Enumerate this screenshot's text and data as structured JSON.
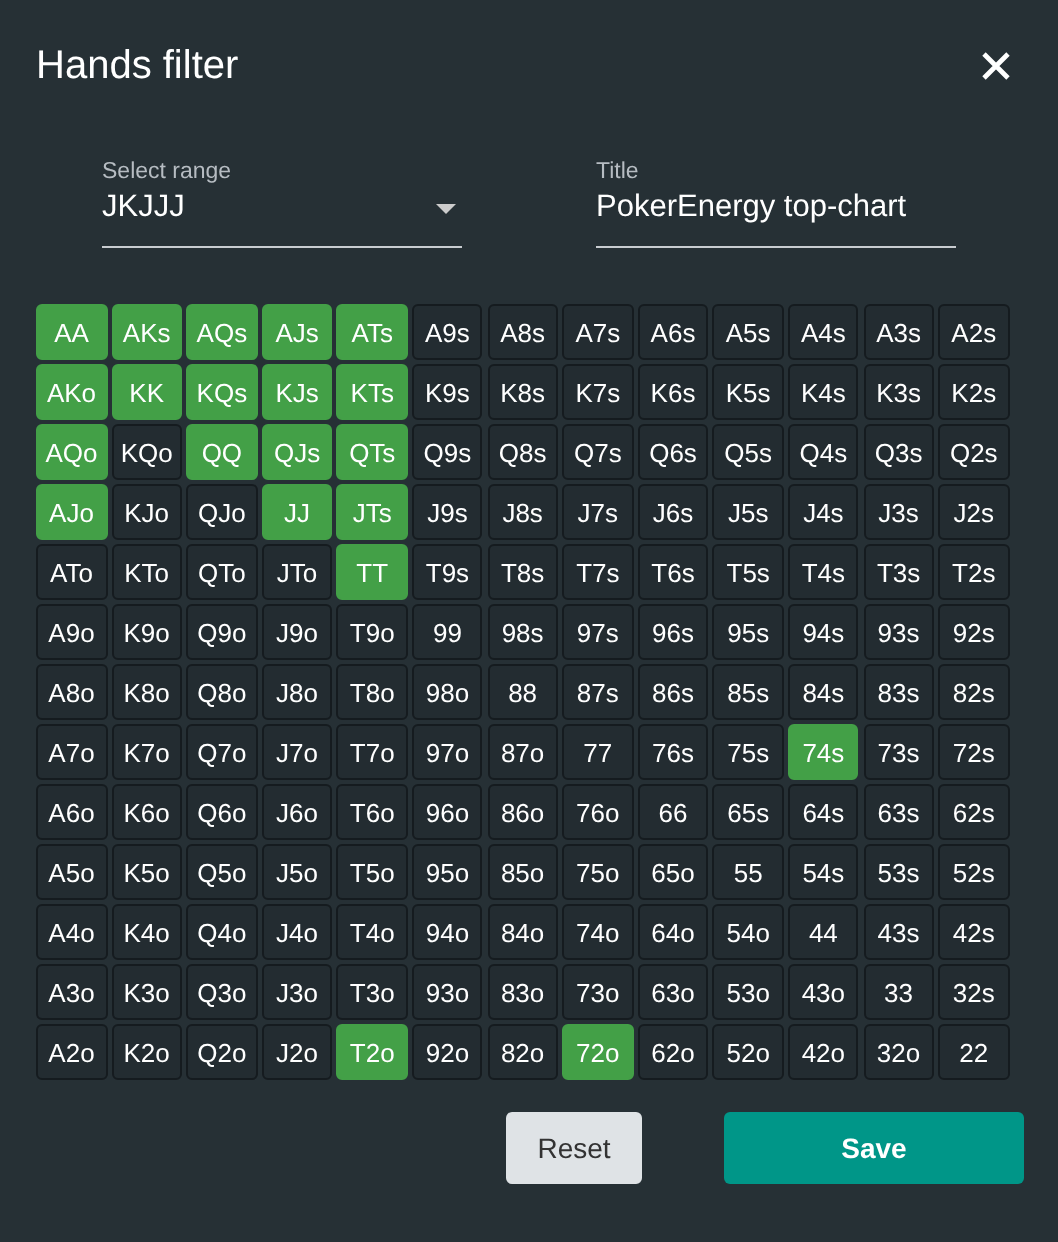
{
  "dialog": {
    "title": "Hands filter"
  },
  "range_select": {
    "label": "Select range",
    "value": "JKJJJ"
  },
  "title_field": {
    "label": "Title",
    "value": "PokerEnergy top-chart"
  },
  "grid": [
    [
      {
        "label": "AA",
        "selected": true
      },
      {
        "label": "AKs",
        "selected": true
      },
      {
        "label": "AQs",
        "selected": true
      },
      {
        "label": "AJs",
        "selected": true
      },
      {
        "label": "ATs",
        "selected": true
      },
      {
        "label": "A9s",
        "selected": false
      },
      {
        "label": "A8s",
        "selected": false
      },
      {
        "label": "A7s",
        "selected": false
      },
      {
        "label": "A6s",
        "selected": false
      },
      {
        "label": "A5s",
        "selected": false
      },
      {
        "label": "A4s",
        "selected": false
      },
      {
        "label": "A3s",
        "selected": false
      },
      {
        "label": "A2s",
        "selected": false
      }
    ],
    [
      {
        "label": "AKo",
        "selected": true
      },
      {
        "label": "KK",
        "selected": true
      },
      {
        "label": "KQs",
        "selected": true
      },
      {
        "label": "KJs",
        "selected": true
      },
      {
        "label": "KTs",
        "selected": true
      },
      {
        "label": "K9s",
        "selected": false
      },
      {
        "label": "K8s",
        "selected": false
      },
      {
        "label": "K7s",
        "selected": false
      },
      {
        "label": "K6s",
        "selected": false
      },
      {
        "label": "K5s",
        "selected": false
      },
      {
        "label": "K4s",
        "selected": false
      },
      {
        "label": "K3s",
        "selected": false
      },
      {
        "label": "K2s",
        "selected": false
      }
    ],
    [
      {
        "label": "AQo",
        "selected": true
      },
      {
        "label": "KQo",
        "selected": false
      },
      {
        "label": "QQ",
        "selected": true
      },
      {
        "label": "QJs",
        "selected": true
      },
      {
        "label": "QTs",
        "selected": true
      },
      {
        "label": "Q9s",
        "selected": false
      },
      {
        "label": "Q8s",
        "selected": false
      },
      {
        "label": "Q7s",
        "selected": false
      },
      {
        "label": "Q6s",
        "selected": false
      },
      {
        "label": "Q5s",
        "selected": false
      },
      {
        "label": "Q4s",
        "selected": false
      },
      {
        "label": "Q3s",
        "selected": false
      },
      {
        "label": "Q2s",
        "selected": false
      }
    ],
    [
      {
        "label": "AJo",
        "selected": true
      },
      {
        "label": "KJo",
        "selected": false
      },
      {
        "label": "QJo",
        "selected": false
      },
      {
        "label": "JJ",
        "selected": true
      },
      {
        "label": "JTs",
        "selected": true
      },
      {
        "label": "J9s",
        "selected": false
      },
      {
        "label": "J8s",
        "selected": false
      },
      {
        "label": "J7s",
        "selected": false
      },
      {
        "label": "J6s",
        "selected": false
      },
      {
        "label": "J5s",
        "selected": false
      },
      {
        "label": "J4s",
        "selected": false
      },
      {
        "label": "J3s",
        "selected": false
      },
      {
        "label": "J2s",
        "selected": false
      }
    ],
    [
      {
        "label": "ATo",
        "selected": false
      },
      {
        "label": "KTo",
        "selected": false
      },
      {
        "label": "QTo",
        "selected": false
      },
      {
        "label": "JTo",
        "selected": false
      },
      {
        "label": "TT",
        "selected": true
      },
      {
        "label": "T9s",
        "selected": false
      },
      {
        "label": "T8s",
        "selected": false
      },
      {
        "label": "T7s",
        "selected": false
      },
      {
        "label": "T6s",
        "selected": false
      },
      {
        "label": "T5s",
        "selected": false
      },
      {
        "label": "T4s",
        "selected": false
      },
      {
        "label": "T3s",
        "selected": false
      },
      {
        "label": "T2s",
        "selected": false
      }
    ],
    [
      {
        "label": "A9o",
        "selected": false
      },
      {
        "label": "K9o",
        "selected": false
      },
      {
        "label": "Q9o",
        "selected": false
      },
      {
        "label": "J9o",
        "selected": false
      },
      {
        "label": "T9o",
        "selected": false
      },
      {
        "label": "99",
        "selected": false
      },
      {
        "label": "98s",
        "selected": false
      },
      {
        "label": "97s",
        "selected": false
      },
      {
        "label": "96s",
        "selected": false
      },
      {
        "label": "95s",
        "selected": false
      },
      {
        "label": "94s",
        "selected": false
      },
      {
        "label": "93s",
        "selected": false
      },
      {
        "label": "92s",
        "selected": false
      }
    ],
    [
      {
        "label": "A8o",
        "selected": false
      },
      {
        "label": "K8o",
        "selected": false
      },
      {
        "label": "Q8o",
        "selected": false
      },
      {
        "label": "J8o",
        "selected": false
      },
      {
        "label": "T8o",
        "selected": false
      },
      {
        "label": "98o",
        "selected": false
      },
      {
        "label": "88",
        "selected": false
      },
      {
        "label": "87s",
        "selected": false
      },
      {
        "label": "86s",
        "selected": false
      },
      {
        "label": "85s",
        "selected": false
      },
      {
        "label": "84s",
        "selected": false
      },
      {
        "label": "83s",
        "selected": false
      },
      {
        "label": "82s",
        "selected": false
      }
    ],
    [
      {
        "label": "A7o",
        "selected": false
      },
      {
        "label": "K7o",
        "selected": false
      },
      {
        "label": "Q7o",
        "selected": false
      },
      {
        "label": "J7o",
        "selected": false
      },
      {
        "label": "T7o",
        "selected": false
      },
      {
        "label": "97o",
        "selected": false
      },
      {
        "label": "87o",
        "selected": false
      },
      {
        "label": "77",
        "selected": false
      },
      {
        "label": "76s",
        "selected": false
      },
      {
        "label": "75s",
        "selected": false
      },
      {
        "label": "74s",
        "selected": true
      },
      {
        "label": "73s",
        "selected": false
      },
      {
        "label": "72s",
        "selected": false
      }
    ],
    [
      {
        "label": "A6o",
        "selected": false
      },
      {
        "label": "K6o",
        "selected": false
      },
      {
        "label": "Q6o",
        "selected": false
      },
      {
        "label": "J6o",
        "selected": false
      },
      {
        "label": "T6o",
        "selected": false
      },
      {
        "label": "96o",
        "selected": false
      },
      {
        "label": "86o",
        "selected": false
      },
      {
        "label": "76o",
        "selected": false
      },
      {
        "label": "66",
        "selected": false
      },
      {
        "label": "65s",
        "selected": false
      },
      {
        "label": "64s",
        "selected": false
      },
      {
        "label": "63s",
        "selected": false
      },
      {
        "label": "62s",
        "selected": false
      }
    ],
    [
      {
        "label": "A5o",
        "selected": false
      },
      {
        "label": "K5o",
        "selected": false
      },
      {
        "label": "Q5o",
        "selected": false
      },
      {
        "label": "J5o",
        "selected": false
      },
      {
        "label": "T5o",
        "selected": false
      },
      {
        "label": "95o",
        "selected": false
      },
      {
        "label": "85o",
        "selected": false
      },
      {
        "label": "75o",
        "selected": false
      },
      {
        "label": "65o",
        "selected": false
      },
      {
        "label": "55",
        "selected": false
      },
      {
        "label": "54s",
        "selected": false
      },
      {
        "label": "53s",
        "selected": false
      },
      {
        "label": "52s",
        "selected": false
      }
    ],
    [
      {
        "label": "A4o",
        "selected": false
      },
      {
        "label": "K4o",
        "selected": false
      },
      {
        "label": "Q4o",
        "selected": false
      },
      {
        "label": "J4o",
        "selected": false
      },
      {
        "label": "T4o",
        "selected": false
      },
      {
        "label": "94o",
        "selected": false
      },
      {
        "label": "84o",
        "selected": false
      },
      {
        "label": "74o",
        "selected": false
      },
      {
        "label": "64o",
        "selected": false
      },
      {
        "label": "54o",
        "selected": false
      },
      {
        "label": "44",
        "selected": false
      },
      {
        "label": "43s",
        "selected": false
      },
      {
        "label": "42s",
        "selected": false
      }
    ],
    [
      {
        "label": "A3o",
        "selected": false
      },
      {
        "label": "K3o",
        "selected": false
      },
      {
        "label": "Q3o",
        "selected": false
      },
      {
        "label": "J3o",
        "selected": false
      },
      {
        "label": "T3o",
        "selected": false
      },
      {
        "label": "93o",
        "selected": false
      },
      {
        "label": "83o",
        "selected": false
      },
      {
        "label": "73o",
        "selected": false
      },
      {
        "label": "63o",
        "selected": false
      },
      {
        "label": "53o",
        "selected": false
      },
      {
        "label": "43o",
        "selected": false
      },
      {
        "label": "33",
        "selected": false
      },
      {
        "label": "32s",
        "selected": false
      }
    ],
    [
      {
        "label": "A2o",
        "selected": false
      },
      {
        "label": "K2o",
        "selected": false
      },
      {
        "label": "Q2o",
        "selected": false
      },
      {
        "label": "J2o",
        "selected": false
      },
      {
        "label": "T2o",
        "selected": true
      },
      {
        "label": "92o",
        "selected": false
      },
      {
        "label": "82o",
        "selected": false
      },
      {
        "label": "72o",
        "selected": true
      },
      {
        "label": "62o",
        "selected": false
      },
      {
        "label": "52o",
        "selected": false
      },
      {
        "label": "42o",
        "selected": false
      },
      {
        "label": "32o",
        "selected": false
      },
      {
        "label": "22",
        "selected": false
      }
    ]
  ],
  "buttons": [
    {
      "kind": "secondary",
      "label": "Reset"
    },
    {
      "kind": "primary",
      "label": "Save"
    }
  ]
}
